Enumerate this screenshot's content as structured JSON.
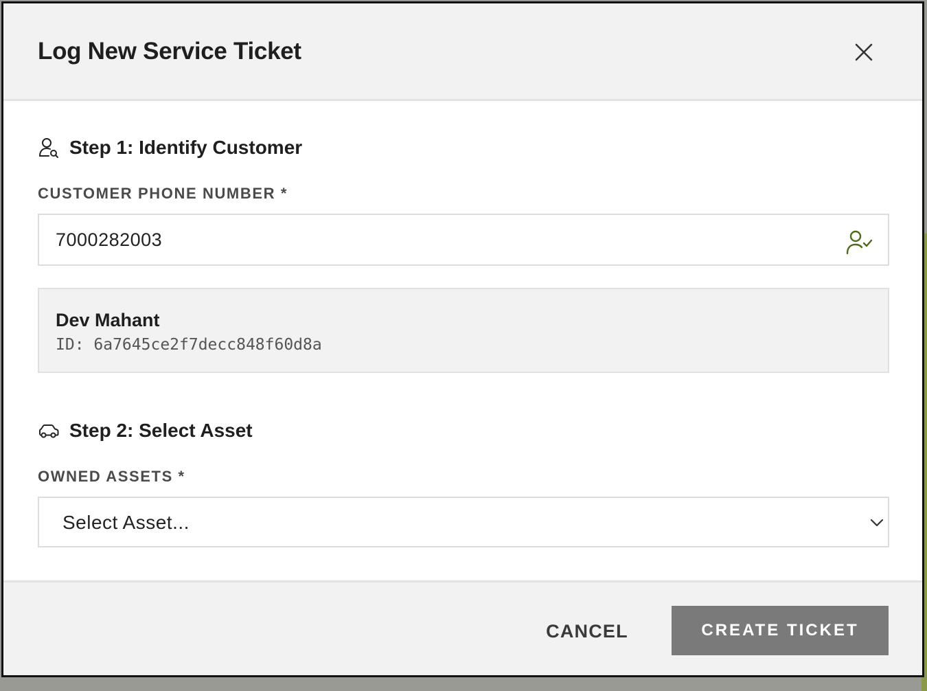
{
  "modal": {
    "title": "Log New Service Ticket"
  },
  "step1": {
    "title": "Step 1: Identify Customer",
    "icon": "user-search-icon",
    "phone_label": "CUSTOMER PHONE NUMBER *",
    "phone_value": "7000282003",
    "phone_status_icon": "user-check-icon",
    "status_color": "#4e6b12"
  },
  "customer": {
    "name": "Dev Mahant",
    "id_line": "ID: 6a7645ce2f7decc848f60d8a"
  },
  "step2": {
    "title": "Step 2: Select Asset",
    "icon": "car-icon",
    "assets_label": "OWNED ASSETS *",
    "assets_selected": "Select Asset..."
  },
  "footer": {
    "cancel_label": "CANCEL",
    "create_label": "CREATE TICKET",
    "create_color": "#7a7a7a"
  }
}
